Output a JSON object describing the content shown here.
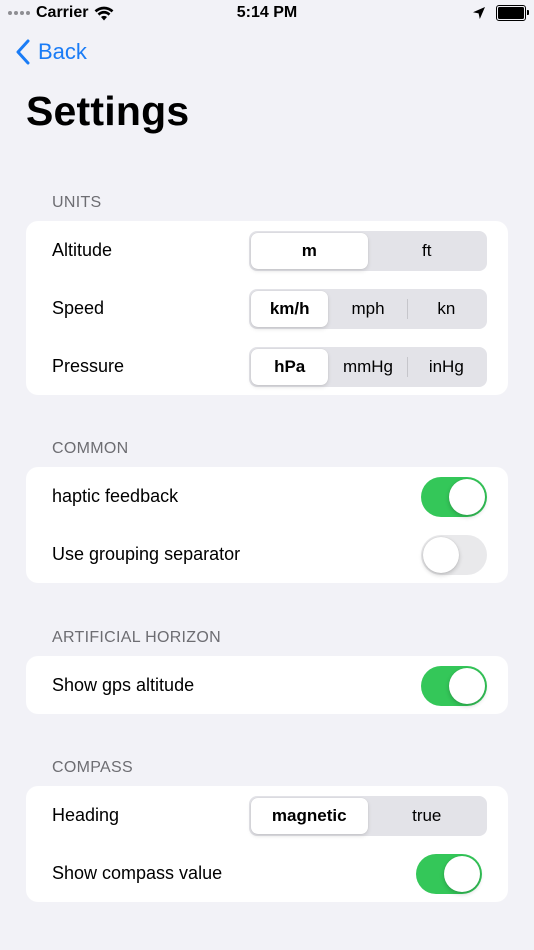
{
  "status_bar": {
    "carrier": "Carrier",
    "time": "5:14 PM"
  },
  "nav": {
    "back_label": "Back"
  },
  "page_title": "Settings",
  "sections": {
    "units": {
      "header": "UNITS",
      "altitude": {
        "label": "Altitude",
        "options": [
          "m",
          "ft"
        ],
        "selected": "m"
      },
      "speed": {
        "label": "Speed",
        "options": [
          "km/h",
          "mph",
          "kn"
        ],
        "selected": "km/h"
      },
      "pressure": {
        "label": "Pressure",
        "options": [
          "hPa",
          "mmHg",
          "inHg"
        ],
        "selected": "hPa"
      }
    },
    "common": {
      "header": "COMMON",
      "haptic": {
        "label": "haptic feedback",
        "on": true
      },
      "grouping": {
        "label": "Use grouping separator",
        "on": false
      }
    },
    "artificial_horizon": {
      "header": "ARTIFICIAL HORIZON",
      "gps_altitude": {
        "label": "Show gps altitude",
        "on": true
      }
    },
    "compass": {
      "header": "COMPASS",
      "heading": {
        "label": "Heading",
        "options": [
          "magnetic",
          "true"
        ],
        "selected": "magnetic"
      },
      "compass_value": {
        "label": "Show compass value",
        "on": true
      }
    }
  },
  "colors": {
    "accent": "#1a7cf6",
    "toggle_on": "#34c759",
    "toggle_off": "#e9e9eb",
    "background": "#f2f2f7"
  },
  "icons": {
    "signal": "signal-dots-icon",
    "wifi": "wifi-icon",
    "location": "location-arrow-icon",
    "battery": "battery-icon",
    "back": "chevron-left-icon"
  }
}
